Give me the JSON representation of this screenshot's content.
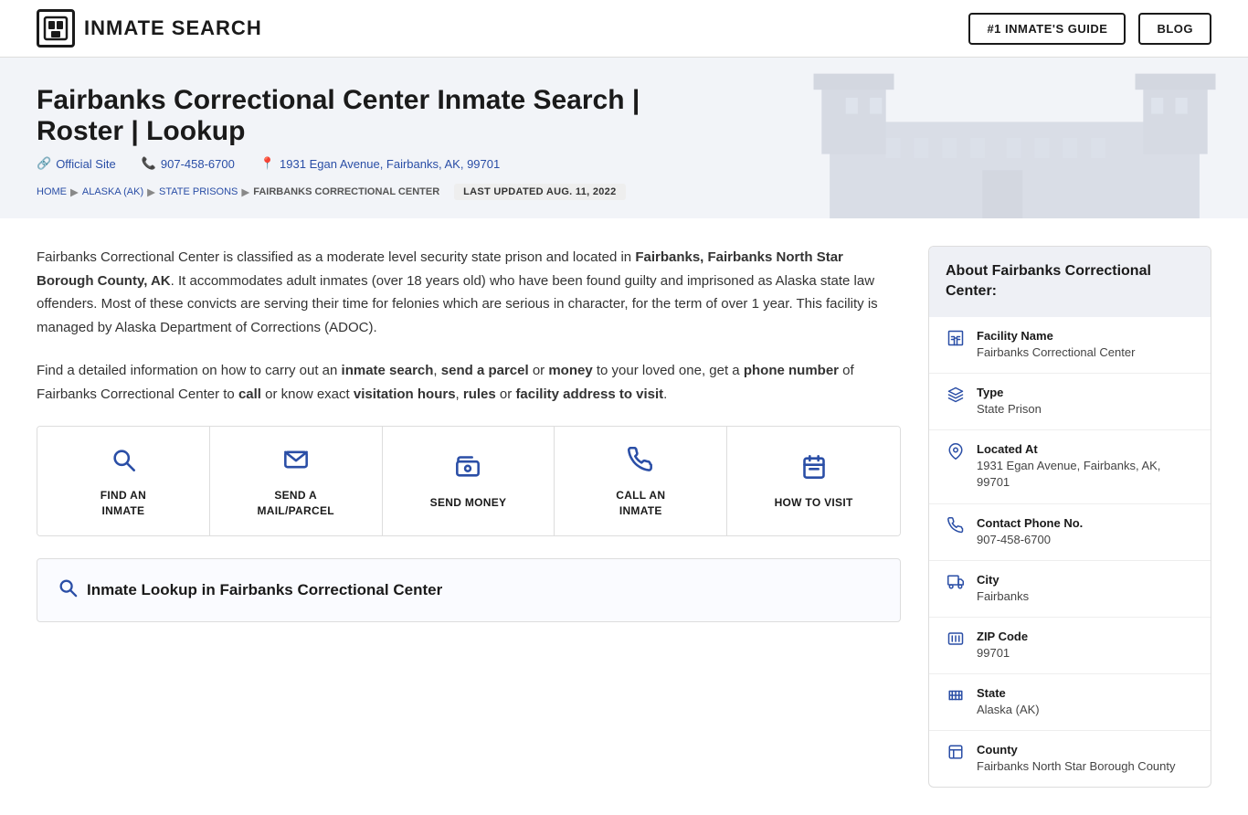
{
  "header": {
    "logo_text": "INMATE SEARCH",
    "nav_guide": "#1 INMATE'S GUIDE",
    "nav_blog": "BLOG"
  },
  "hero": {
    "title": "Fairbanks Correctional Center Inmate Search | Roster | Lookup",
    "official_site": "Official Site",
    "phone": "907-458-6700",
    "address": "1931 Egan Avenue, Fairbanks, AK, 99701",
    "breadcrumb": {
      "home": "HOME",
      "state": "ALASKA (AK)",
      "category": "STATE PRISONS",
      "current": "FAIRBANKS CORRECTIONAL CENTER"
    },
    "last_updated": "LAST UPDATED AUG. 11, 2022"
  },
  "main": {
    "description": {
      "part1": "Fairbanks Correctional Center is classified as a moderate level security state prison and located in ",
      "bold1": "Fairbanks, Fairbanks North Star Borough County, AK",
      "part2": ". It accommodates adult inmates (over 18 years old) who have been found guilty and imprisoned as Alaska state law offenders. Most of these convicts are serving their time for felonies which are serious in character, for the term of over 1 year. This facility is managed by Alaska Department of Corrections (ADOC).",
      "part3": "Find a detailed information on how to carry out an ",
      "bold2": "inmate search",
      "part4": ", ",
      "bold3": "send a parcel",
      "part5": " or ",
      "bold4": "money",
      "part6": " to your loved one, get a ",
      "bold5": "phone number",
      "part7": " of Fairbanks Correctional Center to ",
      "bold6": "call",
      "part8": " or know exact ",
      "bold7": "visitation hours",
      "part9": ", ",
      "bold8": "rules",
      "part10": " or ",
      "bold9": "facility address to visit",
      "part11": "."
    },
    "action_cards": [
      {
        "icon": "🔍",
        "label": "FIND AN\nINMATE"
      },
      {
        "icon": "✉️",
        "label": "SEND A\nMAIL/PARCEL"
      },
      {
        "icon": "💸",
        "label": "SEND MONEY"
      },
      {
        "icon": "📞",
        "label": "CALL AN\nINMATE"
      },
      {
        "icon": "🗓️",
        "label": "HOW TO VISIT"
      }
    ],
    "lookup_heading": "Inmate Lookup in Fairbanks Correctional Center"
  },
  "sidebar": {
    "heading": "About Fairbanks Correctional\nCenter:",
    "rows": [
      {
        "icon": "🏢",
        "label": "Facility Name",
        "value": "Fairbanks Correctional Center"
      },
      {
        "icon": "🔖",
        "label": "Type",
        "value": "State Prison"
      },
      {
        "icon": "📍",
        "label": "Located At",
        "value": "1931 Egan Avenue, Fairbanks, AK, 99701"
      },
      {
        "icon": "📞",
        "label": "Contact Phone No.",
        "value": "907-458-6700"
      },
      {
        "icon": "🏙️",
        "label": "City",
        "value": "Fairbanks"
      },
      {
        "icon": "✉️",
        "label": "ZIP Code",
        "value": "99701"
      },
      {
        "icon": "🗺️",
        "label": "State",
        "value": "Alaska (AK)"
      },
      {
        "icon": "📋",
        "label": "County",
        "value": "Fairbanks North Star Borough County"
      }
    ]
  }
}
